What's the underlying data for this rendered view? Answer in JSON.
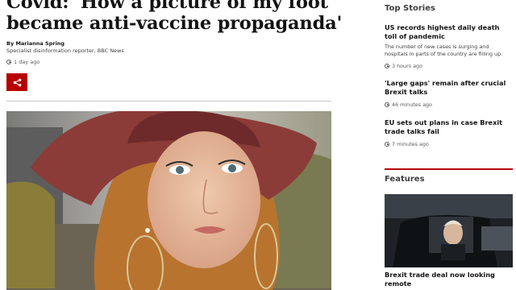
{
  "article": {
    "headline": "Covid: 'How a picture of my foot became anti-vaccine propaganda'",
    "author": "By Marianna Spring",
    "author_role": "Specialist disinformation reporter, BBC News",
    "time": "1 day ago",
    "share_icon": "share-icon",
    "photo_icon": "portrait-photo"
  },
  "sidebar": {
    "top_stories_title": "Top Stories",
    "stories": [
      {
        "title": "US records highest daily death toll of pandemic",
        "summary": "The number of new cases is surging and hospitals in parts of the country are filling up.",
        "time": "3 hours ago"
      },
      {
        "title": "'Large gaps' remain after crucial Brexit talks",
        "time": "46 minutes ago"
      },
      {
        "title": "EU sets out plans in case Brexit trade talks fail",
        "time": "7 minutes ago"
      }
    ],
    "features_title": "Features",
    "feature": {
      "caption": "Brexit trade deal now looking remote"
    }
  },
  "colors": {
    "accent": "#b80000",
    "text": "#141414",
    "muted": "#5a5a5a"
  }
}
